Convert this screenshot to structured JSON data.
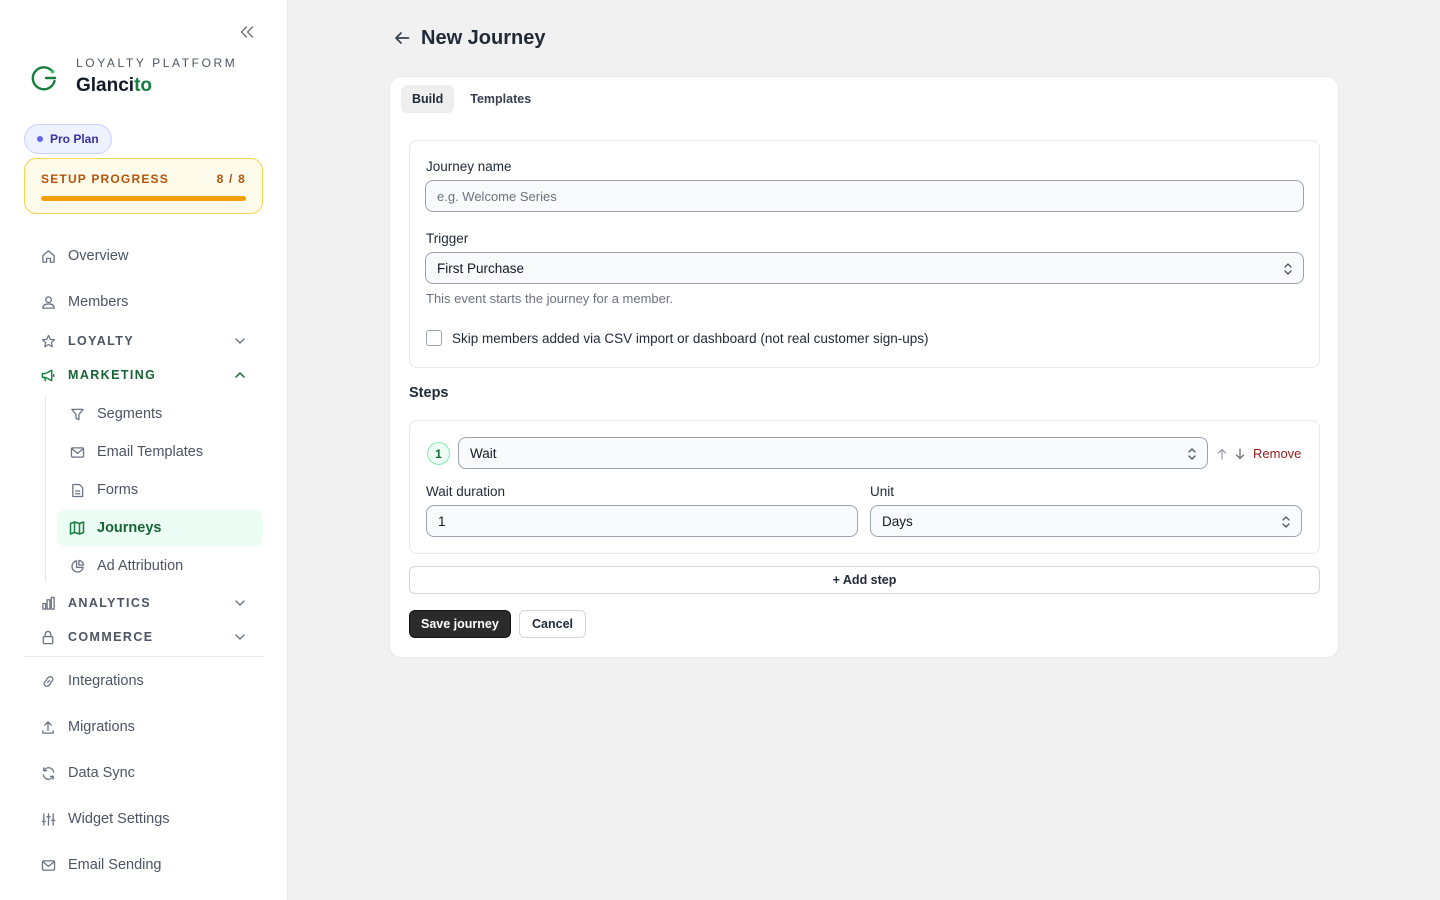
{
  "sidebar": {
    "brand": {
      "subtitle": "LOYALTY PLATFORM",
      "name_main": "Glanci",
      "name_accent": "to"
    },
    "plan_badge": "Pro Plan",
    "setup": {
      "label": "SETUP PROGRESS",
      "count": "8 / 8",
      "progress": 1.0
    },
    "nav": {
      "overview": "Overview",
      "members": "Members",
      "loyalty": "LOYALTY",
      "marketing": "MARKETING",
      "analytics": "ANALYTICS",
      "commerce": "COMMERCE",
      "integrations": "Integrations",
      "migrations": "Migrations",
      "data_sync": "Data Sync",
      "widget_settings": "Widget Settings",
      "email_sending": "Email Sending"
    },
    "marketing_items": {
      "segments": "Segments",
      "email_templates": "Email Templates",
      "forms": "Forms",
      "journeys": "Journeys",
      "ad_attribution": "Ad Attribution"
    }
  },
  "main": {
    "title": "New Journey",
    "tabs": {
      "build": "Build",
      "templates": "Templates"
    },
    "form": {
      "journey_name_label": "Journey name",
      "journey_name_placeholder": "e.g. Welcome Series",
      "journey_name_value": "",
      "trigger_label": "Trigger",
      "trigger_value": "First Purchase",
      "trigger_help": "This event starts the journey for a member.",
      "skip_label": "Skip members added via CSV import or dashboard (not real customer sign-ups)"
    },
    "steps": {
      "heading": "Steps",
      "items": [
        {
          "number": "1",
          "type": "Wait",
          "remove_label": "Remove",
          "duration_label": "Wait duration",
          "duration_value": "1",
          "unit_label": "Unit",
          "unit_value": "Days"
        }
      ],
      "add_label": "+ Add step"
    },
    "actions": {
      "save": "Save journey",
      "cancel": "Cancel"
    }
  },
  "colors": {
    "accent": "#15803d",
    "active_bg": "#ecfdf5",
    "warning": "#f59e0b",
    "danger": "#991b1b",
    "primary_btn": "#2b2b2b"
  }
}
